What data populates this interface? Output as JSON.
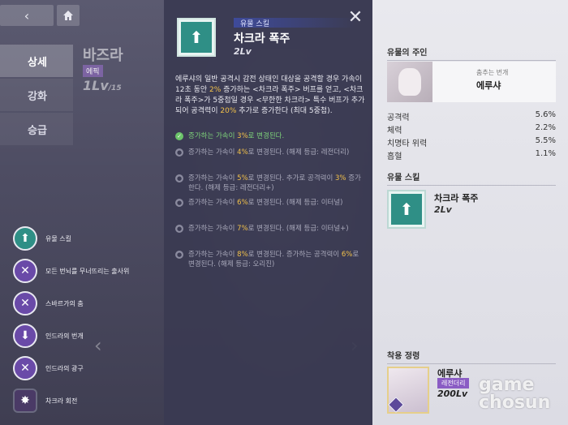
{
  "nav": {
    "back_icon": "back-arrow-icon",
    "home_icon": "home-icon",
    "items": [
      {
        "label": "상세",
        "active": true
      },
      {
        "label": "강화",
        "active": false
      },
      {
        "label": "승급",
        "active": false
      }
    ]
  },
  "background_character": {
    "name": "바즈라",
    "badge": "에픽",
    "level": "1Lv",
    "level_max": "/15"
  },
  "skills": [
    {
      "label": "유물 스킬",
      "icon": "relic-skill-icon"
    },
    {
      "label": "모든 번뇌를 무너뜨리는 출사위",
      "icon": "crossed-swords-icon"
    },
    {
      "label": "스바르가의 춤",
      "icon": "crossed-swords-icon"
    },
    {
      "label": "인드라의 번개",
      "icon": "down-arrow-icon"
    },
    {
      "label": "인드라의 광구",
      "icon": "crossed-swords-icon"
    },
    {
      "label": "차크라 회전",
      "icon": "burst-icon"
    }
  ],
  "popup": {
    "category": "유물 스킬",
    "title": "차크라 폭주",
    "level": "2Lv",
    "description_parts": [
      {
        "t": "에루샤의 일반 공격시 감전 상태인 대상을 공격할 경우 가속이 12초 동안 ",
        "h": false
      },
      {
        "t": "2%",
        "h": true
      },
      {
        "t": " 증가하는 <차크라 폭주> 버프를 얻고, <차크라 폭주>가 5중첩일 경우 <무한한 차크라> 특수 버프가 추가되어 공격력이 ",
        "h": false
      },
      {
        "t": "20%",
        "h": true
      },
      {
        "t": " 추가로 증가한다 (최대 5중첩).",
        "h": false
      }
    ],
    "tiers": [
      {
        "done": true,
        "parts": [
          {
            "t": "증가하는 가속이 ",
            "h": false
          },
          {
            "t": "3%",
            "h": true
          },
          {
            "t": "로 변경된다.",
            "h": false
          }
        ]
      },
      {
        "done": false,
        "parts": [
          {
            "t": "증가하는 가속이 ",
            "h": false
          },
          {
            "t": "4%",
            "h": true
          },
          {
            "t": "로 변경된다. (해제 등급: 레전더리)",
            "h": false
          }
        ]
      },
      {
        "done": false,
        "parts": [
          {
            "t": "증가하는 가속이 ",
            "h": false
          },
          {
            "t": "5%",
            "h": true
          },
          {
            "t": "로 변경된다. 추가로 공격력이 ",
            "h": false
          },
          {
            "t": "3%",
            "h": true
          },
          {
            "t": " 증가한다. (해제 등급: 레전더리+)",
            "h": false
          }
        ]
      },
      {
        "done": false,
        "parts": [
          {
            "t": "증가하는 가속이 ",
            "h": false
          },
          {
            "t": "6%",
            "h": true
          },
          {
            "t": "로 변경된다. (해제 등급: 이터널)",
            "h": false
          }
        ]
      },
      {
        "done": false,
        "parts": [
          {
            "t": "증가하는 가속이 ",
            "h": false
          },
          {
            "t": "7%",
            "h": true
          },
          {
            "t": "로 변경된다. (해제 등급: 이터널+)",
            "h": false
          }
        ]
      },
      {
        "done": false,
        "parts": [
          {
            "t": "증가하는 가속이 ",
            "h": false
          },
          {
            "t": "8%",
            "h": true
          },
          {
            "t": "로 변경된다. 증가하는 공격력이 ",
            "h": false
          },
          {
            "t": "6%",
            "h": true
          },
          {
            "t": "로 변경된다. (해제 등급: 오리진)",
            "h": false
          }
        ]
      }
    ]
  },
  "right": {
    "owner_title": "유물의 주인",
    "owner_subtitle": "춤추는 번개",
    "owner_name": "에루샤",
    "stats": [
      {
        "label": "공격력",
        "value": "5.6%"
      },
      {
        "label": "체력",
        "value": "2.2%"
      },
      {
        "label": "치명타 위력",
        "value": "5.5%"
      },
      {
        "label": "흡혈",
        "value": "1.1%"
      }
    ],
    "relic_skill_title": "유물 스킬",
    "relic_skill_name": "차크라 폭주",
    "relic_skill_level": "2Lv",
    "spirit_title": "착용 정령",
    "spirit_name": "에루샤",
    "spirit_badge": "레전더리",
    "spirit_level": "200Lv"
  },
  "watermark": {
    "line1": "game",
    "line2": "chosun"
  },
  "colors": {
    "highlight": "#f2c14a",
    "relic_teal": "#2f8f86",
    "done_green": "#7ed37a"
  }
}
